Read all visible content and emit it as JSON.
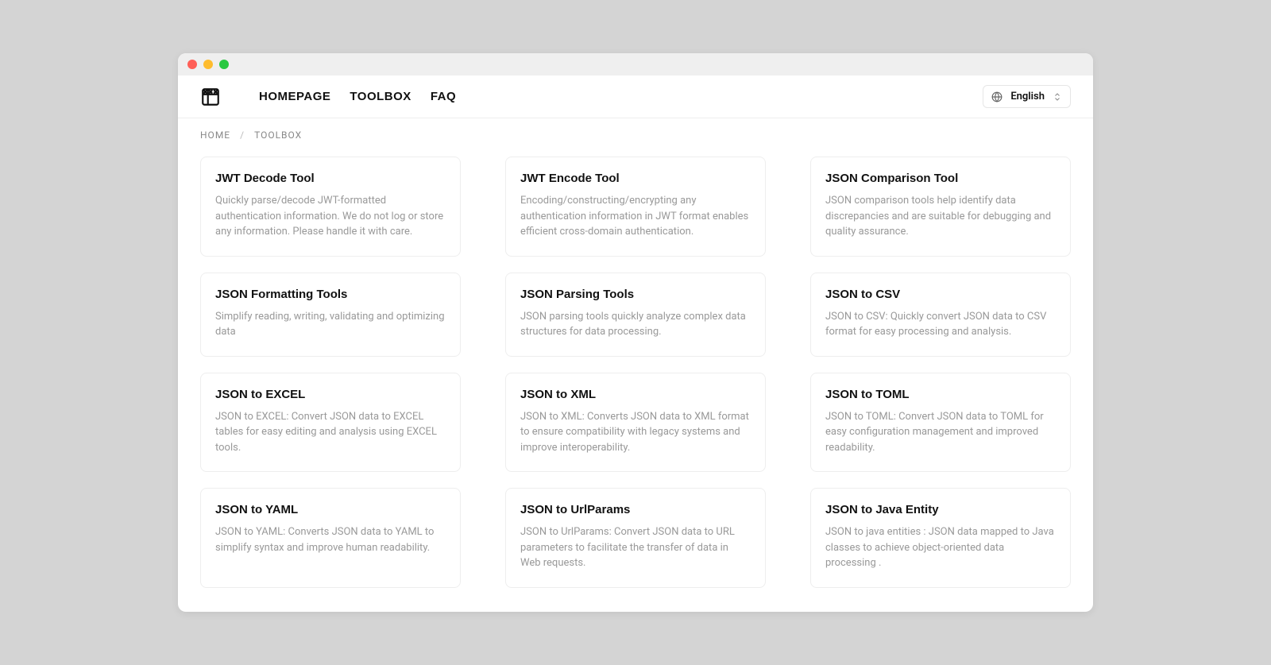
{
  "nav": {
    "items": [
      {
        "label": "HOMEPAGE"
      },
      {
        "label": "TOOLBOX"
      },
      {
        "label": "FAQ"
      }
    ]
  },
  "language": {
    "selected": "English"
  },
  "breadcrumb": {
    "items": [
      {
        "label": "HOME"
      },
      {
        "label": "TOOLBOX"
      }
    ]
  },
  "tools": [
    {
      "title": "JWT Decode Tool",
      "desc": "Quickly parse/decode JWT-formatted authentication information. We do not log or store any information. Please handle it with care."
    },
    {
      "title": "JWT Encode Tool",
      "desc": "Encoding/constructing/encrypting any authentication information in JWT format enables efficient cross-domain authentication."
    },
    {
      "title": "JSON Comparison Tool",
      "desc": "JSON comparison tools help identify data discrepancies and are suitable for debugging and quality assurance."
    },
    {
      "title": "JSON Formatting Tools",
      "desc": "Simplify reading, writing, validating and optimizing data"
    },
    {
      "title": "JSON Parsing Tools",
      "desc": "JSON parsing tools quickly analyze complex data structures for data processing."
    },
    {
      "title": "JSON to CSV",
      "desc": "JSON to CSV: Quickly convert JSON data to CSV format for easy processing and analysis."
    },
    {
      "title": "JSON to EXCEL",
      "desc": "JSON to EXCEL: Convert JSON data to EXCEL tables for easy editing and analysis using EXCEL tools."
    },
    {
      "title": "JSON to XML",
      "desc": "JSON to XML: Converts JSON data to XML format to ensure compatibility with legacy systems and improve interoperability."
    },
    {
      "title": "JSON to TOML",
      "desc": "JSON to TOML: Convert JSON data to TOML for easy configuration management and improved readability."
    },
    {
      "title": "JSON to YAML",
      "desc": "JSON to YAML: Converts JSON data to YAML to simplify syntax and improve human readability."
    },
    {
      "title": "JSON to UrlParams",
      "desc": "JSON to UrlParams: Convert JSON data to URL parameters to facilitate the transfer of data in Web requests."
    },
    {
      "title": "JSON to Java Entity",
      "desc": "JSON to java entities : JSON data mapped to Java classes to achieve object-oriented data processing ."
    }
  ]
}
